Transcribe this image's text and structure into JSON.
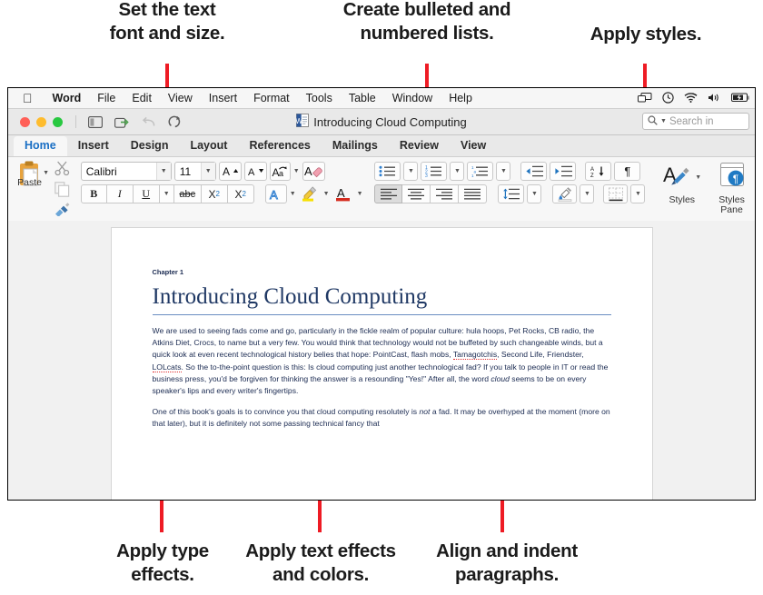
{
  "callouts": {
    "top": [
      {
        "id": "font",
        "text": "Set the text\nfont and size."
      },
      {
        "id": "lists",
        "text": "Create bulleted and\nnumbered lists."
      },
      {
        "id": "styles",
        "text": "Apply styles."
      }
    ],
    "bottom": [
      {
        "id": "type-effects",
        "text": "Apply type\neffects."
      },
      {
        "id": "text-effects",
        "text": "Apply text effects\nand colors."
      },
      {
        "id": "align",
        "text": "Align and indent\nparagraphs."
      }
    ],
    "line_color": "#ee1b24"
  },
  "menubar": {
    "apple_icon": "apple-icon",
    "items": [
      "Word",
      "File",
      "Edit",
      "View",
      "Insert",
      "Format",
      "Tools",
      "Table",
      "Window",
      "Help"
    ],
    "status_icons": [
      "screen-mirroring-icon",
      "time-machine-icon",
      "wifi-icon",
      "volume-icon",
      "battery-icon"
    ]
  },
  "titlebar": {
    "document_title": "Introducing Cloud Computing",
    "doc_icon": "word-document-icon",
    "quick_access": [
      "sidebar-toggle-icon",
      "share-icon",
      "undo-icon",
      "redo-icon"
    ],
    "search_placeholder": "Search in",
    "search_icon": "search-icon"
  },
  "ribbon_tabs": {
    "items": [
      "Home",
      "Insert",
      "Design",
      "Layout",
      "References",
      "Mailings",
      "Review",
      "View"
    ],
    "active": "Home",
    "active_color": "#1a6fc4"
  },
  "ribbon": {
    "clipboard": {
      "paste_label": "Paste",
      "paste_icon": "paste-icon",
      "cut_icon": "scissors-icon",
      "copy_icon": "copy-icon",
      "format_painter_icon": "format-painter-icon"
    },
    "font": {
      "font_name": "Calibri",
      "font_size": "11",
      "grow_font_icon": "grow-font-icon",
      "shrink_font_icon": "shrink-font-icon",
      "change_case_icon": "change-case-icon",
      "clear_formatting_icon": "clear-formatting-icon",
      "bold": "B",
      "italic": "I",
      "underline": "U",
      "strikethrough": "abc",
      "subscript": "X2",
      "superscript": "X2",
      "text_effects_icon": "text-effects-icon",
      "highlight_icon": "highlight-color-icon",
      "font_color_icon": "font-color-icon",
      "highlight_color": "#f7e000",
      "font_color": "#d52b1e"
    },
    "paragraph": {
      "bullets_icon": "bulleted-list-icon",
      "numbering_icon": "numbered-list-icon",
      "multilevel_icon": "multilevel-list-icon",
      "decrease_indent_icon": "decrease-indent-icon",
      "increase_indent_icon": "increase-indent-icon",
      "sort_icon": "sort-az-icon",
      "show_marks_icon": "pilcrow-icon",
      "align_left_icon": "align-left-icon",
      "align_center_icon": "align-center-icon",
      "align_right_icon": "align-right-icon",
      "justify_icon": "justify-icon",
      "line_spacing_icon": "line-spacing-icon",
      "shading_icon": "shading-icon",
      "borders_icon": "borders-icon"
    },
    "styles": {
      "styles_label": "Styles",
      "styles_icon": "styles-icon",
      "styles_pane_label": "Styles\nPane",
      "styles_pane_icon": "styles-pane-icon"
    }
  },
  "document": {
    "chapter_label": "Chapter 1",
    "heading": "Introducing Cloud Computing",
    "heading_color": "#1f3864",
    "paragraphs": [
      {
        "id": "p1",
        "runs": [
          {
            "t": "We are used to seeing fads come and go, particularly in the fickle realm of popular culture: hula hoops, Pet Rocks, CB radio, the Atkins Diet, Crocs, to name but a very few. You would think that technology would not be buffeted by such changeable winds, but a quick look at even recent technological history belies that hope: PointCast, flash mobs, "
          },
          {
            "t": "Tamagotchis",
            "style": "spell"
          },
          {
            "t": ", Second Life, Friendster, "
          },
          {
            "t": "LOLcats",
            "style": "spell"
          },
          {
            "t": ". So the to-the-point question is this: Is cloud computing just another technological fad? If you talk to people in IT or read the business press, you'd be forgiven for thinking the answer is a resounding \"Yes!\" After all, the word "
          },
          {
            "t": "cloud",
            "style": "italic"
          },
          {
            "t": " seems to be on every speaker's lips and every writer's fingertips."
          }
        ]
      },
      {
        "id": "p2",
        "runs": [
          {
            "t": "One of this book's goals is to convince you that cloud computing resolutely is "
          },
          {
            "t": "not",
            "style": "italic"
          },
          {
            "t": " a fad. It may be overhyped at the moment (more on that later), but it is definitely not some passing technical fancy that"
          }
        ]
      }
    ]
  }
}
